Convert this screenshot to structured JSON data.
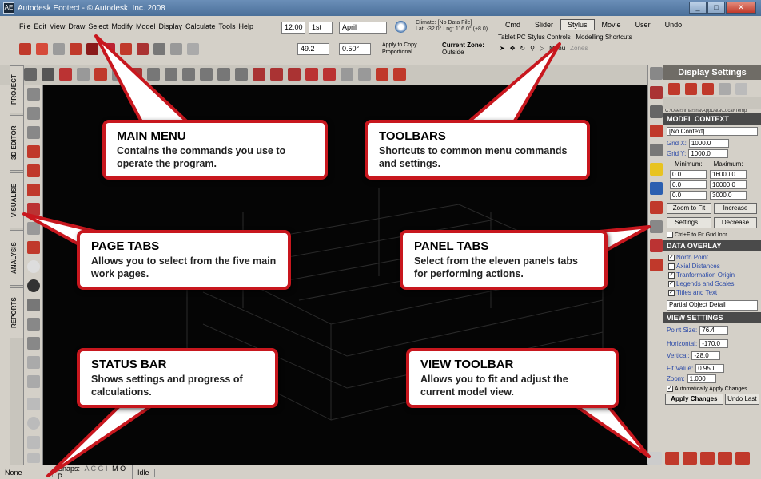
{
  "window": {
    "title": "Autodesk Ecotect - © Autodesk, Inc. 2008",
    "logo_text": "AE"
  },
  "menubar": {
    "items": [
      "File",
      "Edit",
      "View",
      "Draw",
      "Select",
      "Modify",
      "Model",
      "Display",
      "Calculate",
      "Tools",
      "Help"
    ]
  },
  "time_controls": {
    "time": "12:00",
    "day": "1st",
    "month": "April"
  },
  "climate": {
    "line1": "Climate: [No Data File]",
    "line2": "Lat: -32.0°  Lng: 116.0° (+8.0)"
  },
  "mode_tabs": {
    "items": [
      "Cmd",
      "Slider",
      "Stylus",
      "Movie",
      "User",
      "Undo"
    ],
    "active": "Stylus",
    "stylus_controls": "Tablet PC Stylus Controls",
    "modelling_shortcuts": "Modelling Shortcuts",
    "menu_label": "Menu",
    "zones_label": "Zones"
  },
  "toolbar2": {
    "angle_value": "49.2",
    "step_value": "0.50°",
    "apply_line1": "Apply to Copy",
    "apply_line2": "Proportional",
    "outside": "Outside",
    "current_zone": "Current Zone:"
  },
  "page_tabs": [
    "PROJECT",
    "3D EDITOR",
    "VISUALISE",
    "ANALYSIS",
    "REPORTS"
  ],
  "panel": {
    "title": "Display Settings",
    "path": "C:\\Users\\marsha\\AppData\\Local\\Temp",
    "model_context": {
      "header": "MODEL CONTEXT",
      "context_value": "[No Context]",
      "grid_x_label": "Grid X:",
      "grid_x": "1000.0",
      "grid_y_label": "Grid Y:",
      "grid_y": "1000.0",
      "min_label": "Minimum:",
      "max_label": "Maximum:",
      "x_min": "0.0",
      "x_max": "16000.0",
      "y_min": "0.0",
      "y_max": "10000.0",
      "z_min": "0.0",
      "z_max": "3000.0",
      "zoom_fit": "Zoom to Fit",
      "increase": "Increase",
      "settings": "Settings...",
      "decrease": "Decrease",
      "ctrl_f": "Ctrl+F to Fit Grid Incr."
    },
    "data_overlay": {
      "header": "DATA OVERLAY",
      "items": [
        {
          "label": "North Point",
          "checked": true
        },
        {
          "label": "Axial Distances",
          "checked": false
        },
        {
          "label": "Tranformation Origin",
          "checked": true
        },
        {
          "label": "Legends and Scales",
          "checked": true
        },
        {
          "label": "Titles and Text",
          "checked": true
        }
      ],
      "detail": "Partial Object Detail"
    },
    "view_settings": {
      "header": "VIEW SETTINGS",
      "point_size_label": "Point Size:",
      "point_size": "76.4",
      "horizontal_label": "Horizontal:",
      "horizontal": "-170.0",
      "vertical_label": "Vertical:",
      "vertical": "-28.0",
      "fit_value_label": "Fit Value:",
      "fit_value": "0.950",
      "zoom_label": "Zoom:",
      "zoom": "1.000",
      "auto_apply": "Automatically Apply Changes",
      "apply_changes": "Apply Changes",
      "undo_last": "Undo Last"
    }
  },
  "status": {
    "mode": "None",
    "snaps": "Snaps:",
    "snap_codes": "A C G I",
    "extra": "M O P",
    "state": "Idle"
  },
  "callouts": {
    "main_menu": {
      "title": "MAIN MENU",
      "text": "Contains the commands you use to operate the program."
    },
    "toolbars": {
      "title": "TOOLBARS",
      "text": "Shortcuts to common menu commands and settings."
    },
    "page_tabs": {
      "title": "PAGE TABS",
      "text": "Allows you to select from the five main work pages."
    },
    "panel_tabs": {
      "title": "PANEL TABS",
      "text": "Select from the eleven panels tabs for performing actions."
    },
    "status_bar": {
      "title": "STATUS BAR",
      "text": "Shows settings and progress of calculations."
    },
    "view_toolbar": {
      "title": "VIEW TOOLBAR",
      "text": "Allows you to fit and adjust the current model view."
    }
  },
  "colors": {
    "callout_border": "#c8171e",
    "viewport_bg": "#050505",
    "panel_header": "#4a4a4a"
  }
}
